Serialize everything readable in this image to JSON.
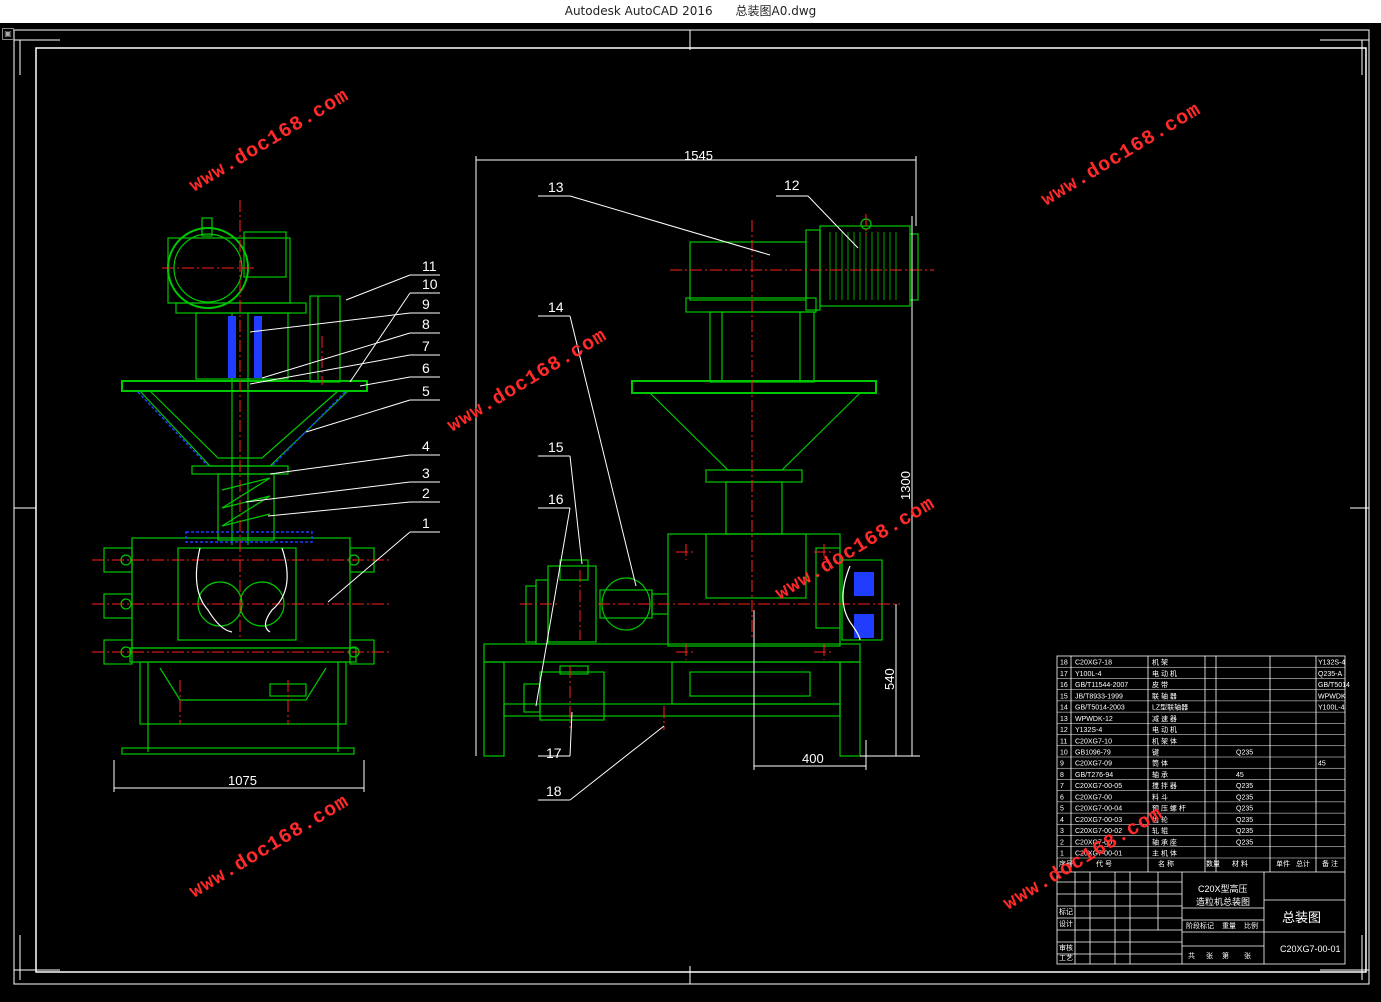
{
  "window": {
    "app": "Autodesk AutoCAD 2016",
    "file": "总装图A0.dwg"
  },
  "dimensions": {
    "overall_width": "1545",
    "height": "1300",
    "base_height": "540",
    "offset": "400",
    "front_width": "1075"
  },
  "part_labels": {
    "front": [
      "11",
      "10",
      "9",
      "8",
      "7",
      "6",
      "5",
      "4",
      "3",
      "2",
      "1"
    ],
    "side": [
      "13",
      "12",
      "14",
      "15",
      "16",
      "17",
      "18"
    ]
  },
  "watermark": "www.doc168.com",
  "title_block": {
    "title_line1": "C20X型高压",
    "title_line2": "造粒机总装图",
    "drawing_name": "总装图",
    "drawing_number": "C20XG7-00-01",
    "bom_rows": [
      {
        "no": "18",
        "code": "C20XG7-18",
        "name": "机 架"
      },
      {
        "no": "17",
        "code": "Y100L-4",
        "name": "电 动 机"
      },
      {
        "no": "16",
        "code": "GB/T11544-2007",
        "name": "皮 带"
      },
      {
        "no": "15",
        "code": "JB/T8933-1999",
        "name": "联 轴 器"
      },
      {
        "no": "14",
        "code": "GB/T5014-2003",
        "name": "LZ型联轴器"
      },
      {
        "no": "13",
        "code": "WPWDK-12",
        "name": "减 速 器"
      },
      {
        "no": "12",
        "code": "Y132S-4",
        "name": "电 动 机"
      },
      {
        "no": "11",
        "code": "C20XG7-10",
        "name": "机 架 体"
      },
      {
        "no": "10",
        "code": "GB1096-79",
        "name": "键"
      },
      {
        "no": "9",
        "code": "C20XG7-09",
        "name": "筒 体"
      },
      {
        "no": "8",
        "code": "GB/T276-94",
        "name": "轴 承"
      },
      {
        "no": "7",
        "code": "C20XG7-00-05",
        "name": "搅 拌 器"
      },
      {
        "no": "6",
        "code": "C20XG7-00",
        "name": "料 斗"
      },
      {
        "no": "5",
        "code": "C20XG7-00-04",
        "name": "预 压 螺 杆"
      },
      {
        "no": "4",
        "code": "C20XG7-00-03",
        "name": "齿 轮"
      },
      {
        "no": "3",
        "code": "C20XG7-00-02",
        "name": "轧 辊"
      },
      {
        "no": "2",
        "code": "C20XG7-00",
        "name": "轴 承 座"
      },
      {
        "no": "1",
        "code": "C20XG7-00-01",
        "name": "主 机 体"
      }
    ],
    "bom_right": [
      "Y132S-4",
      "Q235-A",
      "GB/T5014",
      "WPWDK",
      "Y100L-4",
      "",
      "",
      "",
      "",
      "45",
      "",
      "",
      "",
      "",
      "",
      "",
      "",
      ""
    ],
    "bom_mid": [
      "",
      "",
      "",
      "",
      "",
      "",
      "",
      "",
      "Q235",
      "",
      "45",
      "Q235",
      "Q235",
      "Q235",
      "Q235",
      "Q235",
      "Q235",
      ""
    ],
    "col_headers": [
      "序号",
      "代 号",
      "名 称",
      "数量",
      "材 料",
      "单件",
      "总计",
      "重 量",
      "备 注"
    ],
    "sign_rows": [
      "标记",
      "设计",
      "审核",
      "工艺"
    ],
    "stage_labels": [
      "阶段标记",
      "重量",
      "比例"
    ],
    "sheet_labels": [
      "共",
      "张",
      "第",
      "张"
    ]
  },
  "colors": {
    "drawing_green": "#00c800",
    "center_red": "#ff2020",
    "leader_white": "#ffffff",
    "watermark_red": "#ff2a2a",
    "blue_part": "#1f3cff"
  }
}
